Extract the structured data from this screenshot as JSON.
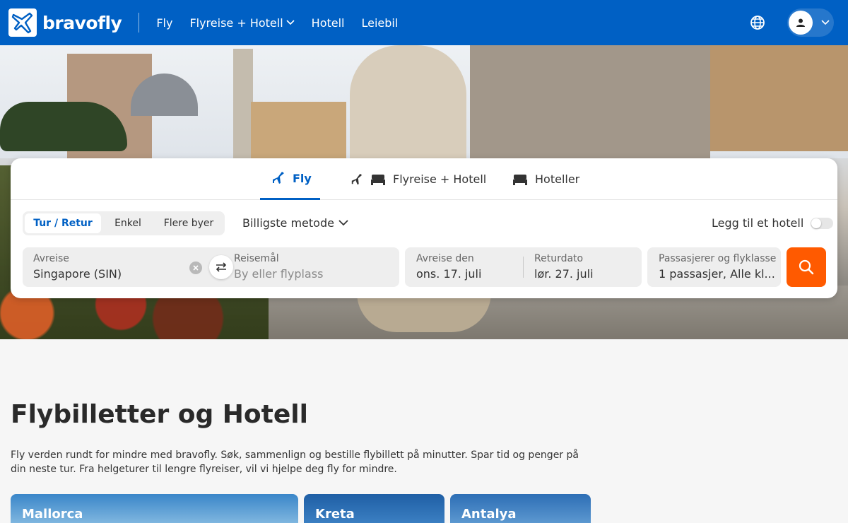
{
  "brand": {
    "name": "bravofly"
  },
  "nav": {
    "items": [
      {
        "label": "Fly"
      },
      {
        "label": "Flyreise + Hotell"
      },
      {
        "label": "Hotell"
      },
      {
        "label": "Leiebil"
      }
    ]
  },
  "search": {
    "tabs": [
      {
        "label": "Fly",
        "active": true
      },
      {
        "label": "Flyreise + Hotell",
        "active": false
      },
      {
        "label": "Hoteller",
        "active": false
      }
    ],
    "trip_types": [
      {
        "label": "Tur / Retur",
        "active": true
      },
      {
        "label": "Enkel",
        "active": false
      },
      {
        "label": "Flere byer",
        "active": false
      }
    ],
    "sort": "Billigste metode",
    "add_hotel": {
      "label": "Legg til et hotell",
      "on": false
    },
    "origin": {
      "label": "Avreise",
      "value": "Singapore (SIN)"
    },
    "destination": {
      "label": "Reisemål",
      "placeholder": "By eller flyplass"
    },
    "depart": {
      "label": "Avreise den",
      "value": "ons. 17. juli"
    },
    "return": {
      "label": "Returdato",
      "value": "lør. 27. juli"
    },
    "passengers": {
      "label": "Passasjerer og flyklasse",
      "value": "1 passasjer, Alle kl..."
    }
  },
  "content": {
    "title": "Flybilletter og Hotell",
    "description": "Fly verden rundt for mindre med bravofly. Søk, sammenlign og bestille flybillett på minutter. Spar tid og penger på din neste tur. Fra helgeturer til lengre flyreiser, vil vi hjelpe deg fly for mindre.",
    "destinations": [
      {
        "label": "Mallorca"
      },
      {
        "label": "Kreta"
      },
      {
        "label": "Antalya"
      }
    ]
  },
  "colors": {
    "brand": "#0060c4",
    "search": "#ff5a00"
  }
}
